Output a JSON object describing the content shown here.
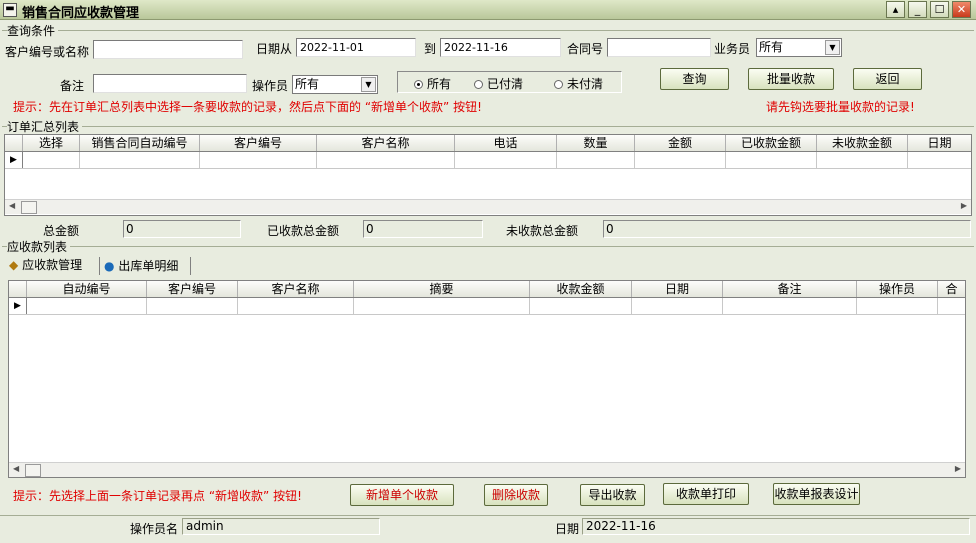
{
  "window": {
    "title": "销售合同应收款管理"
  },
  "query": {
    "group_title": "查询条件",
    "customer_label": "客户编号或名称",
    "customer_value": "",
    "date_from_label": "日期从",
    "date_from": "2022-11-01",
    "date_to_label": "到",
    "date_to": "2022-11-16",
    "contract_label": "合同号",
    "contract_value": "",
    "salesman_label": "业务员",
    "salesman_value": "所有",
    "remark_label": "备注",
    "remark_value": "",
    "operator_label": "操作员",
    "operator_value": "所有",
    "radio_all": "所有",
    "radio_paid": "已付清",
    "radio_unpaid": "未付清",
    "btn_query": "查询",
    "btn_batch": "批量收款",
    "btn_back": "返回",
    "hint_left": "提示：先在订单汇总列表中选择一条要收款的记录，然后点下面的 “新增单个收款” 按钮!",
    "hint_right": "请先钩选要批量收款的记录!"
  },
  "orders": {
    "group_title": "订单汇总列表",
    "columns": [
      "选择",
      "销售合同自动编号",
      "客户编号",
      "客户名称",
      "电话",
      "数量",
      "金额",
      "已收款金额",
      "未收款金额",
      "日期"
    ],
    "total_label": "总金额",
    "total_value": "0",
    "received_label": "已收款总金额",
    "received_value": "0",
    "unreceived_label": "未收款总金额",
    "unreceived_value": "0"
  },
  "receivables": {
    "group_title": "应收款列表",
    "tab1": "应收款管理",
    "tab2": "出库单明细",
    "columns": [
      "自动编号",
      "客户编号",
      "客户名称",
      "摘要",
      "收款金额",
      "日期",
      "备注",
      "操作员",
      "合"
    ],
    "hint": "提示：先选择上面一条订单记录再点 “新增收款” 按钮!",
    "btn_add": "新增单个收款",
    "btn_delete": "删除收款",
    "btn_export": "导出收款",
    "btn_print": "收款单打印",
    "btn_design": "收款单报表设计"
  },
  "status": {
    "operator_label": "操作员名",
    "operator_value": "admin",
    "date_label": "日期",
    "date_value": "2022-11-16"
  },
  "icons": {
    "title": "window-menu-icon",
    "tab1": "box-icon",
    "tab2": "globe-icon"
  }
}
